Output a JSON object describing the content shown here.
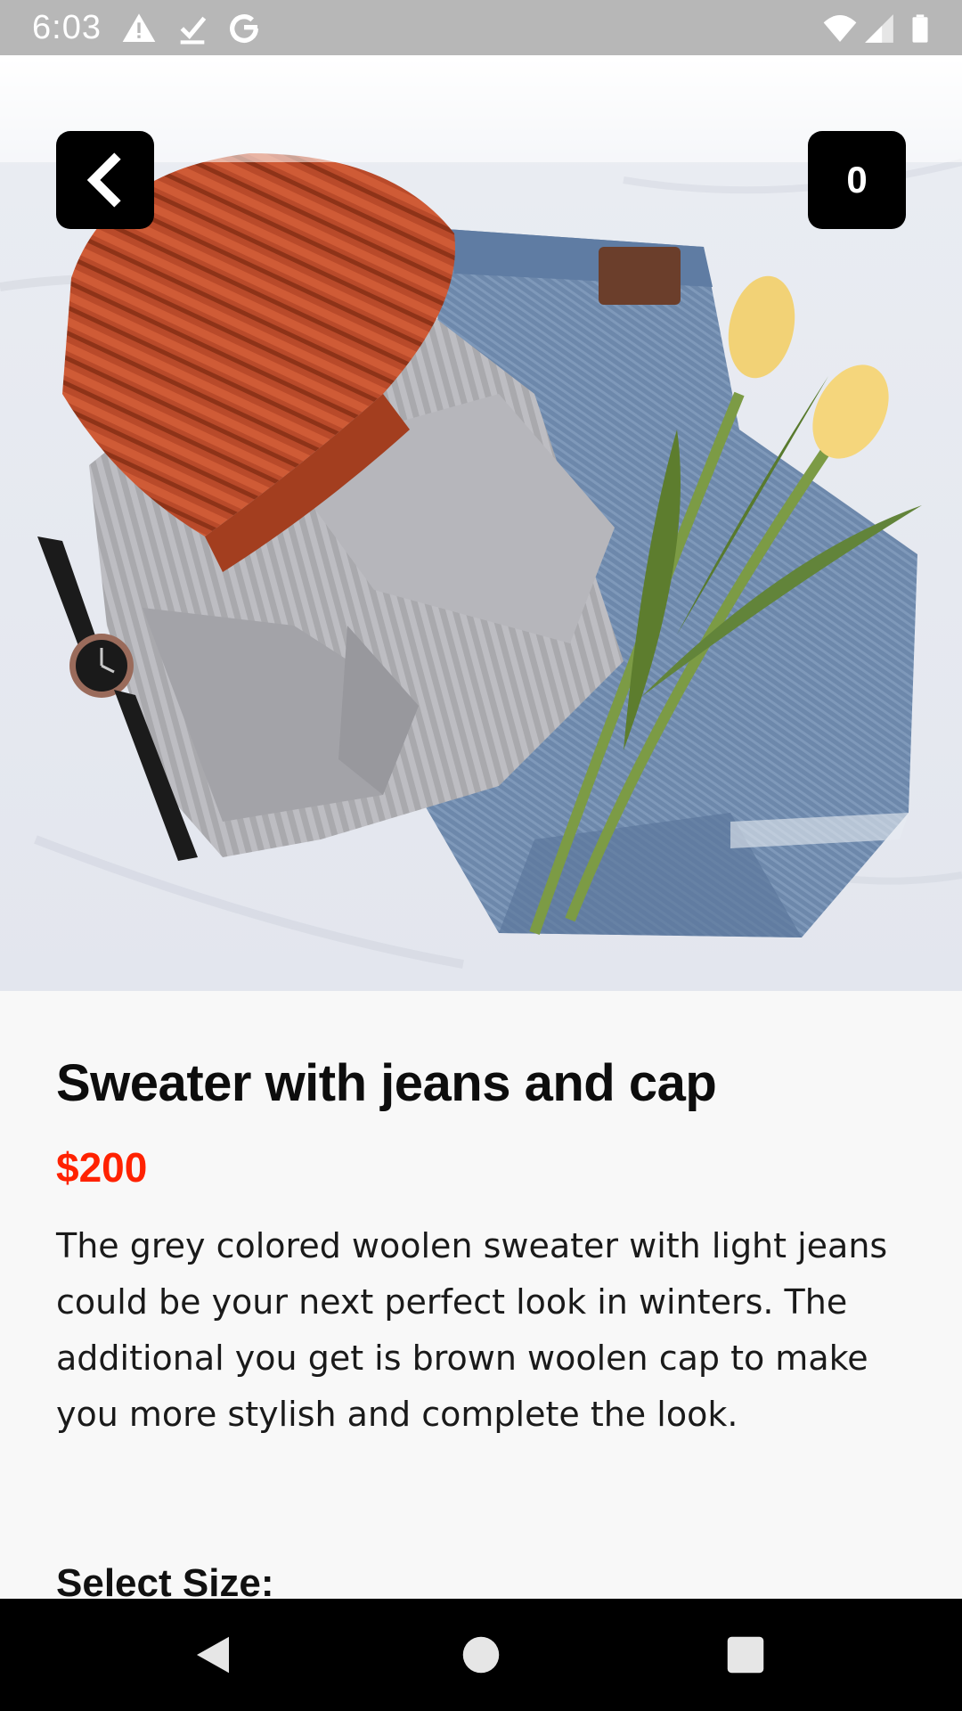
{
  "status_bar": {
    "time": "6:03",
    "left_icons": [
      "warning-icon",
      "download-done-icon",
      "google-icon"
    ],
    "right_icons": [
      "wifi-icon",
      "cell-signal-icon",
      "battery-icon"
    ]
  },
  "header": {
    "back_icon": "chevron-left-icon",
    "cart_count": "0"
  },
  "product": {
    "title": "Sweater with jeans and cap",
    "price": "$200",
    "description": "The grey colored woolen sweater with light jeans could be your next perfect look in winters. The additional you get is brown woolen cap to make you more stylish and complete the look.",
    "select_size_label": "Select Size:"
  },
  "colors": {
    "price": "#ff2200",
    "button_bg": "#000000",
    "background": "#f8f8f8"
  },
  "nav_bar": {
    "icons": [
      "back-triangle-icon",
      "home-circle-icon",
      "recents-square-icon"
    ]
  }
}
